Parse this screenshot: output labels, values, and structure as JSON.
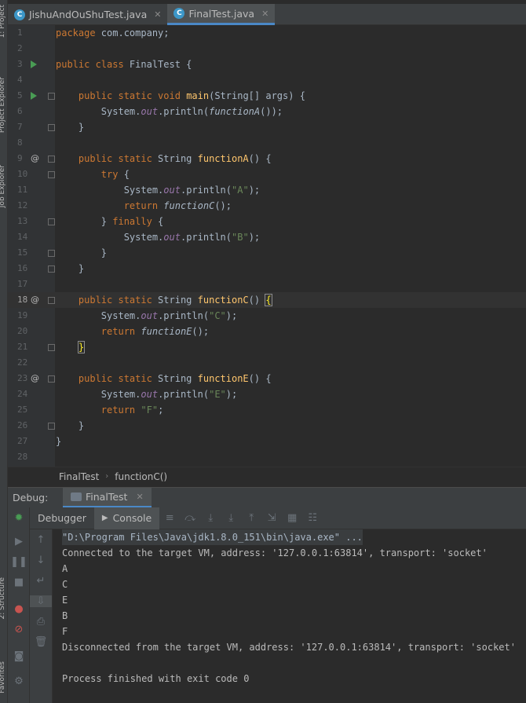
{
  "tabs": [
    {
      "label": "JishuAndOuShuTest.java",
      "icon": "c-class-icon"
    },
    {
      "label": "FinalTest.java",
      "icon": "c-class-icon",
      "active": true
    }
  ],
  "side_labels": {
    "project": "1: Project",
    "project_explorer": "Project Explorer",
    "job_explorer": "Job Explorer",
    "structure": "2: Structure",
    "favorites": "Favorites"
  },
  "code_lines": [
    "1",
    "2",
    "3",
    "4",
    "5",
    "6",
    "7",
    "8",
    "9",
    "10",
    "11",
    "12",
    "13",
    "14",
    "15",
    "16",
    "17",
    "18",
    "19",
    "20",
    "21",
    "22",
    "23",
    "24",
    "25",
    "26",
    "27",
    "28"
  ],
  "breadcrumb": {
    "class": "FinalTest",
    "method": "functionC()"
  },
  "debug": {
    "title": "Debug:",
    "session": "FinalTest",
    "tabs": {
      "debugger": "Debugger",
      "console": "Console"
    }
  },
  "console": {
    "command": "\"D:\\Program Files\\Java\\jdk1.8.0_151\\bin\\java.exe\" ...",
    "lines": [
      "Connected to the target VM, address: '127.0.0.1:63814', transport: 'socket'",
      "A",
      "C",
      "E",
      "B",
      "F",
      "Disconnected from the target VM, address: '127.0.0.1:63814', transport: 'socket'",
      "",
      "Process finished with exit code 0"
    ]
  },
  "colors": {
    "keyword": "#cc7832",
    "method": "#ffc66d",
    "string": "#6a8759",
    "field": "#9876aa",
    "text": "#a9b7c6",
    "run": "#499c54"
  }
}
